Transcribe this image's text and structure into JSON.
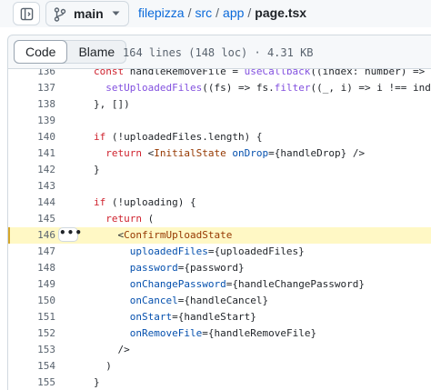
{
  "breadcrumb": {
    "branch": "main",
    "repo": "filepizza",
    "sep": "/",
    "dir1": "src",
    "dir2": "app",
    "file": "page.tsx"
  },
  "toolbar": {
    "code_label": "Code",
    "blame_label": "Blame",
    "meta": "164 lines (148 loc) · 4.31 KB"
  },
  "highlight_line": "146",
  "actions_label": "•••",
  "code_lines": [
    {
      "n": "136",
      "parts": [
        [
          "k",
          "const"
        ],
        [
          "p",
          " handleRemoveFile = "
        ],
        [
          "f",
          "useCallback"
        ],
        [
          "p",
          "((index: number) => {"
        ]
      ]
    },
    {
      "n": "137",
      "parts": [
        [
          "p",
          "  "
        ],
        [
          "f",
          "setUploadedFiles"
        ],
        [
          "p",
          "((fs) => fs."
        ],
        [
          "f",
          "filter"
        ],
        [
          "p",
          "((_, i) => i !== index))"
        ]
      ]
    },
    {
      "n": "138",
      "parts": [
        [
          "p",
          "}, [])"
        ]
      ]
    },
    {
      "n": "139",
      "parts": []
    },
    {
      "n": "140",
      "parts": [
        [
          "k",
          "if"
        ],
        [
          "p",
          " (!uploadedFiles.length) {"
        ]
      ]
    },
    {
      "n": "141",
      "parts": [
        [
          "p",
          "  "
        ],
        [
          "k",
          "return"
        ],
        [
          "p",
          " <"
        ],
        [
          "t",
          "InitialState"
        ],
        [
          "p",
          " "
        ],
        [
          "a",
          "onDrop"
        ],
        [
          "p",
          "={handleDrop} />"
        ]
      ]
    },
    {
      "n": "142",
      "parts": [
        [
          "p",
          "}"
        ]
      ]
    },
    {
      "n": "143",
      "parts": []
    },
    {
      "n": "144",
      "parts": [
        [
          "k",
          "if"
        ],
        [
          "p",
          " (!uploading) {"
        ]
      ]
    },
    {
      "n": "145",
      "parts": [
        [
          "p",
          "  "
        ],
        [
          "k",
          "return"
        ],
        [
          "p",
          " ("
        ]
      ]
    },
    {
      "n": "146",
      "parts": [
        [
          "p",
          "    <"
        ],
        [
          "t",
          "ConfirmUploadState"
        ]
      ]
    },
    {
      "n": "147",
      "parts": [
        [
          "p",
          "      "
        ],
        [
          "a",
          "uploadedFiles"
        ],
        [
          "p",
          "={uploadedFiles}"
        ]
      ]
    },
    {
      "n": "148",
      "parts": [
        [
          "p",
          "      "
        ],
        [
          "a",
          "password"
        ],
        [
          "p",
          "={password}"
        ]
      ]
    },
    {
      "n": "149",
      "parts": [
        [
          "p",
          "      "
        ],
        [
          "a",
          "onChangePassword"
        ],
        [
          "p",
          "={handleChangePassword}"
        ]
      ]
    },
    {
      "n": "150",
      "parts": [
        [
          "p",
          "      "
        ],
        [
          "a",
          "onCancel"
        ],
        [
          "p",
          "={handleCancel}"
        ]
      ]
    },
    {
      "n": "151",
      "parts": [
        [
          "p",
          "      "
        ],
        [
          "a",
          "onStart"
        ],
        [
          "p",
          "={handleStart}"
        ]
      ]
    },
    {
      "n": "152",
      "parts": [
        [
          "p",
          "      "
        ],
        [
          "a",
          "onRemoveFile"
        ],
        [
          "p",
          "={handleRemoveFile}"
        ]
      ]
    },
    {
      "n": "153",
      "parts": [
        [
          "p",
          "    />"
        ]
      ]
    },
    {
      "n": "154",
      "parts": [
        [
          "p",
          "  )"
        ]
      ]
    },
    {
      "n": "155",
      "parts": [
        [
          "p",
          "}"
        ]
      ]
    }
  ],
  "colors": {
    "link": "#0969da",
    "keyword": "#cf222e",
    "function": "#8250df",
    "tag": "#953800",
    "attribute": "#0550ae",
    "highlight_bg": "#fff8c5"
  },
  "icons": [
    "sidebar-toggle-icon",
    "git-branch-icon",
    "caret-down-icon",
    "kebab-icon"
  ]
}
